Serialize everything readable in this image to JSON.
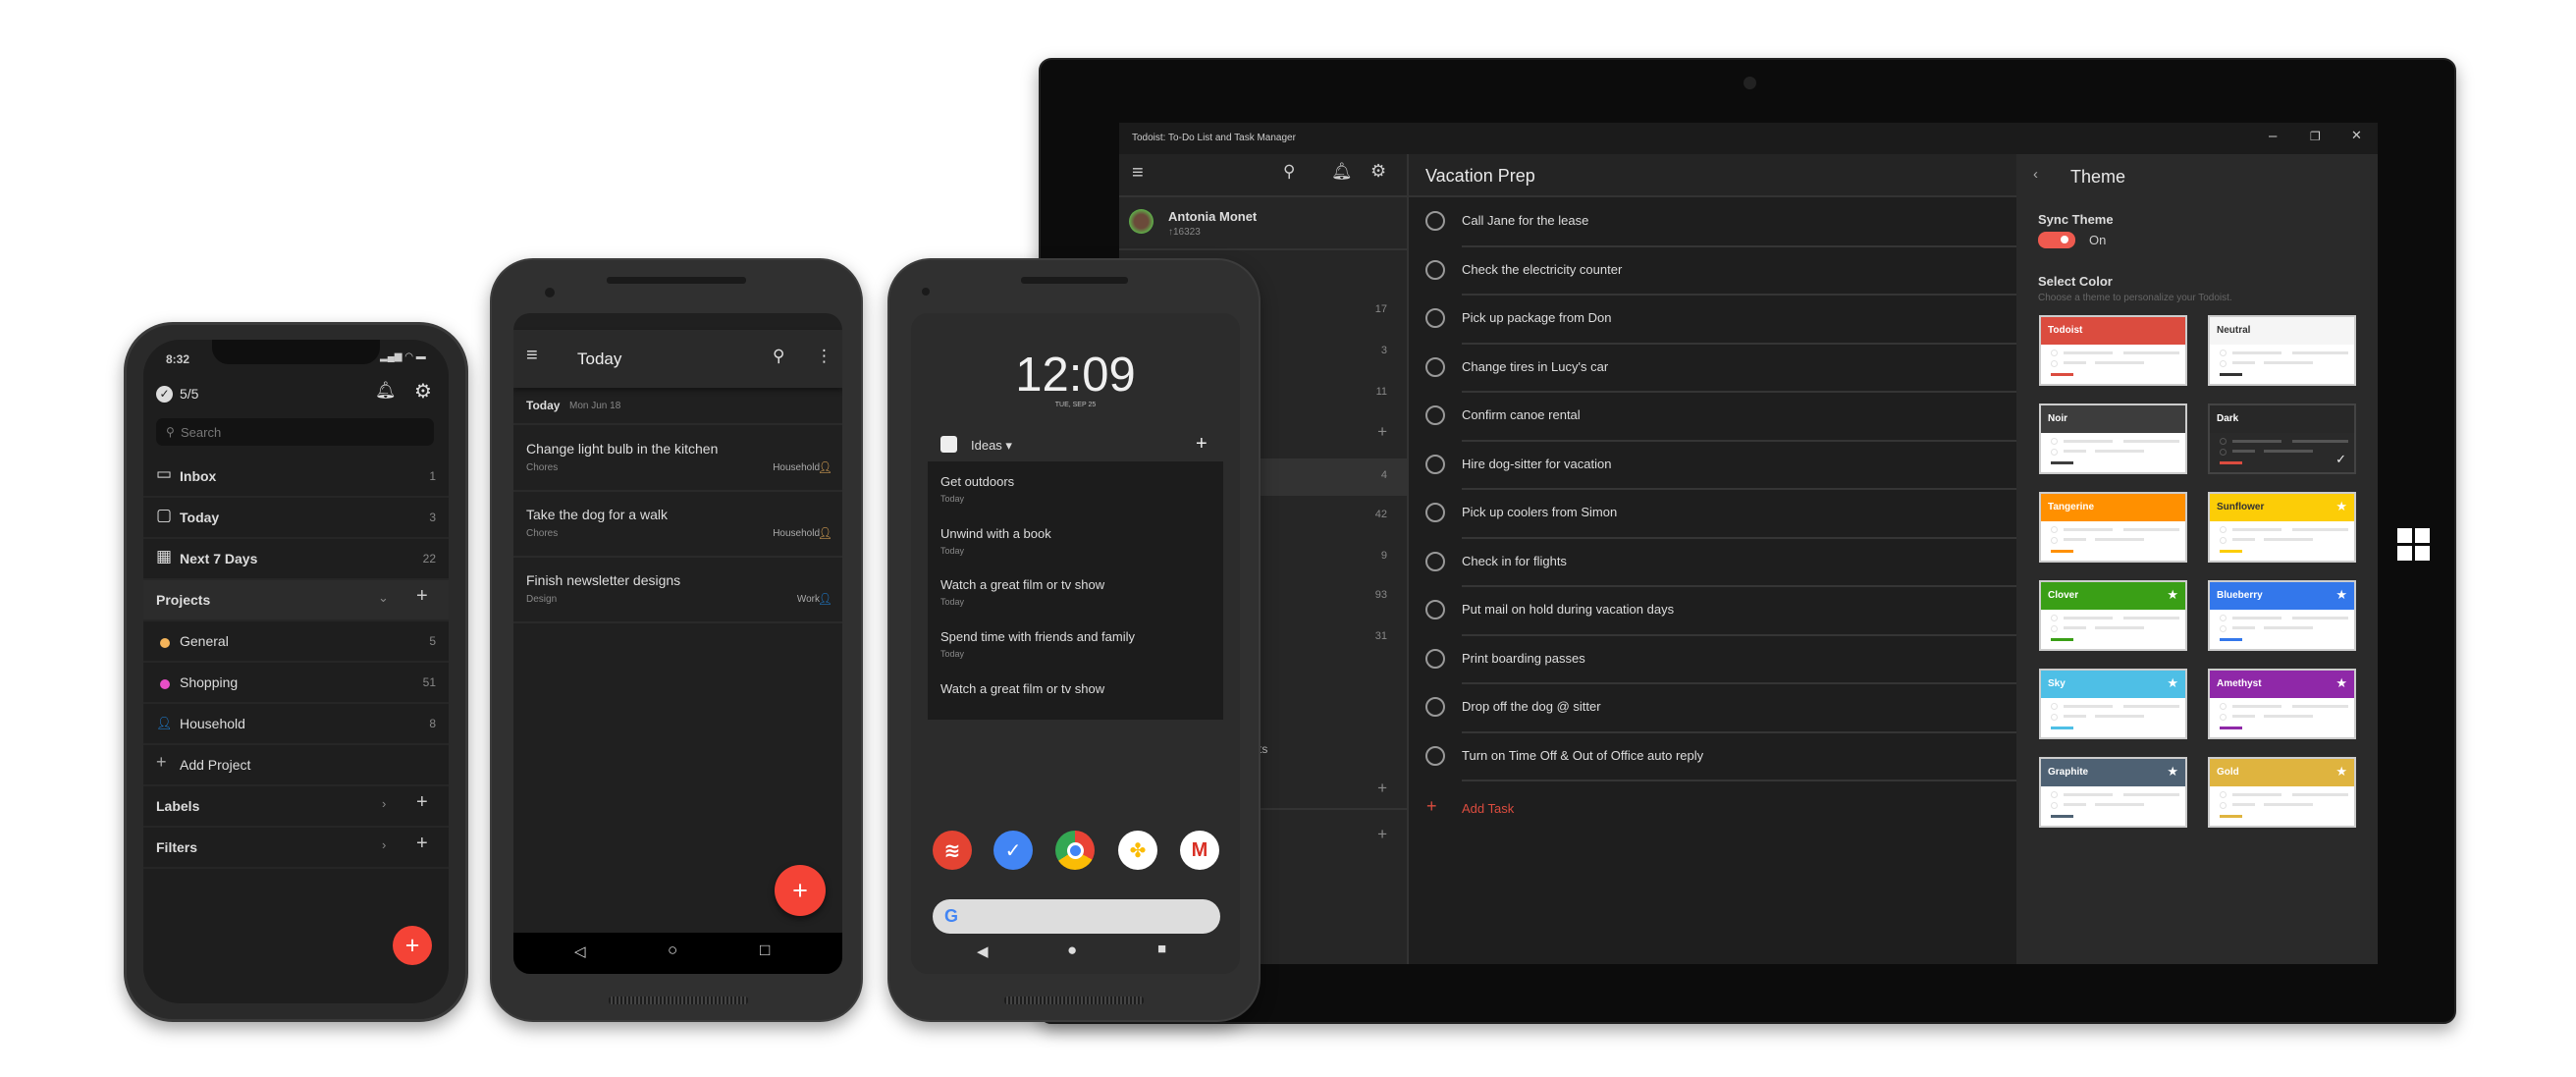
{
  "iphone": {
    "status_time": "8:32",
    "karma": "5/5",
    "search_placeholder": "Search",
    "nav": [
      {
        "label": "Inbox",
        "count": "1",
        "icon": "inbox-icon"
      },
      {
        "label": "Today",
        "count": "3",
        "icon": "calendar-today-icon"
      },
      {
        "label": "Next 7 Days",
        "count": "22",
        "icon": "calendar-week-icon"
      }
    ],
    "projects_header": "Projects",
    "projects": [
      {
        "label": "General",
        "count": "5",
        "color": "#f5b55b"
      },
      {
        "label": "Shopping",
        "count": "51",
        "color": "#e84fc7"
      },
      {
        "label": "Household",
        "count": "8",
        "color": "#1e88e5"
      }
    ],
    "add_project": "Add Project",
    "labels_header": "Labels",
    "filters_header": "Filters",
    "fab_color": "#f44336"
  },
  "android_app": {
    "title": "Today",
    "date_heading": "Today",
    "date": "Mon Jun 18",
    "tasks": [
      {
        "name": "Change light bulb in the kitchen",
        "label": "Chores",
        "project": "Household",
        "project_color": "#f5b55b"
      },
      {
        "name": "Take the dog for a walk",
        "label": "Chores",
        "project": "Household",
        "project_color": "#f5b55b"
      },
      {
        "name": "Finish newsletter designs",
        "label": "Design",
        "project": "Work",
        "project_color": "#1e88e5"
      }
    ]
  },
  "android_widget": {
    "clock": "12:09",
    "date": "TUE, SEP 25",
    "widget_title": "Ideas",
    "items": [
      {
        "name": "Get outdoors",
        "due": "Today"
      },
      {
        "name": "Unwind with a book",
        "due": "Today"
      },
      {
        "name": "Watch a great film or tv show",
        "due": "Today"
      },
      {
        "name": "Spend time with friends and family",
        "due": "Today"
      },
      {
        "name": "Watch a great film or tv show",
        "due": ""
      }
    ],
    "apps": [
      "todoist-app-icon",
      "inbox-app-icon",
      "chrome-app-icon",
      "photos-app-icon",
      "gmail-app-icon"
    ]
  },
  "tablet": {
    "window_title": "Todoist: To-Do List and Task Manager",
    "user_name": "Antonia Monet",
    "karma": "16323",
    "sidebar_counts": [
      "17",
      "3",
      "11",
      "+",
      "4",
      "42",
      "9",
      "93",
      "31"
    ],
    "sidebar_partial_label": "ts",
    "project_title": "Vacation Prep",
    "tasks": [
      "Call Jane for the lease",
      "Check the electricity counter",
      "Pick up package from Don",
      "Change tires in Lucy's car",
      "Confirm canoe rental",
      "Hire dog-sitter for vacation",
      "Pick up coolers from Simon",
      "Check in for flights",
      "Put mail on hold during vacation days",
      "Print boarding passes",
      "Drop off the dog @ sitter",
      "Turn on Time Off & Out of Office auto reply"
    ],
    "add_task": "Add Task",
    "theme": {
      "title": "Theme",
      "sync_label": "Sync Theme",
      "sync_state": "On",
      "select_label": "Select Color",
      "select_hint": "Choose a theme to personalize your Todoist.",
      "themes": [
        {
          "name": "Todoist",
          "color": "#db4c3f",
          "premium": false
        },
        {
          "name": "Neutral",
          "color": "#f5f5f5",
          "premium": false
        },
        {
          "name": "Noir",
          "color": "#3d3d3d",
          "premium": false
        },
        {
          "name": "Dark",
          "color": "#282828",
          "premium": false,
          "selected": true
        },
        {
          "name": "Tangerine",
          "color": "#ff9000",
          "premium": false
        },
        {
          "name": "Sunflower",
          "color": "#fccd07",
          "premium": true
        },
        {
          "name": "Clover",
          "color": "#3a9f16",
          "premium": true
        },
        {
          "name": "Blueberry",
          "color": "#3377eb",
          "premium": true
        },
        {
          "name": "Sky",
          "color": "#4ebfe6",
          "premium": true
        },
        {
          "name": "Amethyst",
          "color": "#8f28a8",
          "premium": true
        },
        {
          "name": "Graphite",
          "color": "#4e6173",
          "premium": true
        },
        {
          "name": "Gold",
          "color": "#dfb43f",
          "premium": true
        }
      ]
    }
  }
}
